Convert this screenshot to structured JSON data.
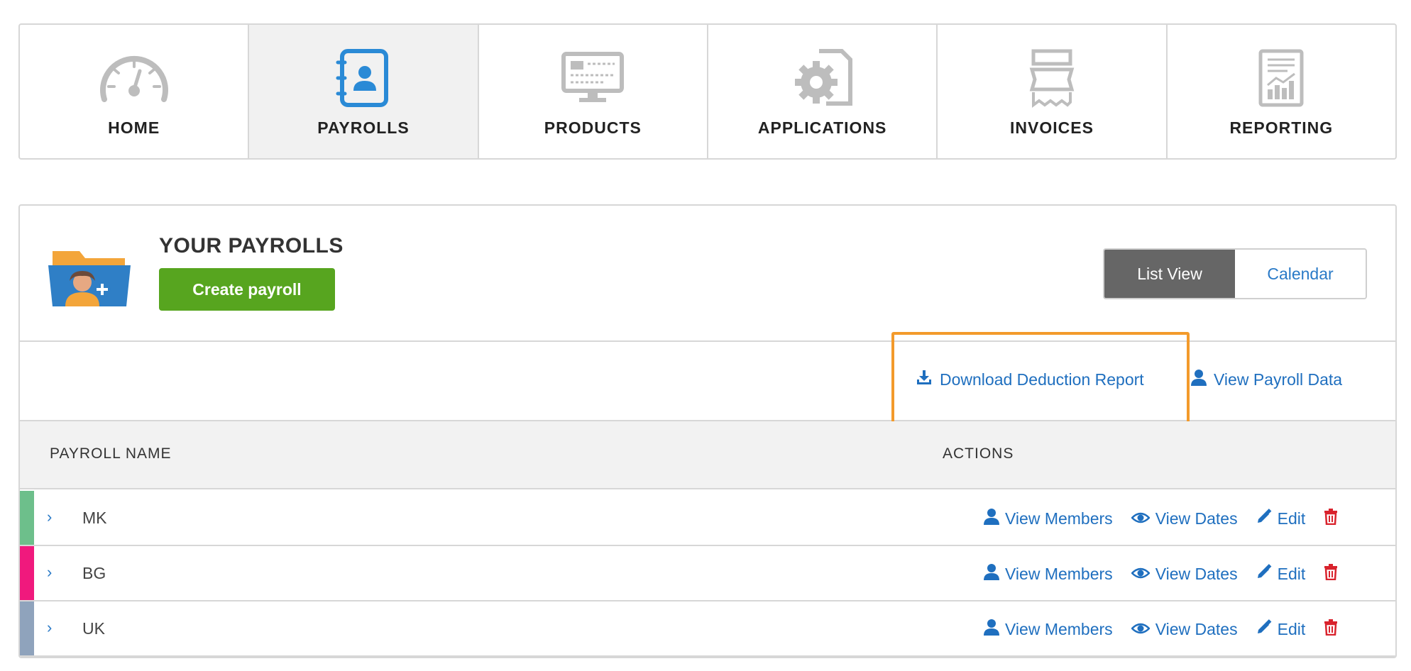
{
  "nav": {
    "tiles": [
      {
        "label": "HOME",
        "icon": "speedometer-icon"
      },
      {
        "label": "PAYROLLS",
        "icon": "contacts-book-icon"
      },
      {
        "label": "PRODUCTS",
        "icon": "monitor-icon"
      },
      {
        "label": "APPLICATIONS",
        "icon": "gear-document-icon"
      },
      {
        "label": "INVOICES",
        "icon": "receipt-icon"
      },
      {
        "label": "REPORTING",
        "icon": "report-chart-icon"
      }
    ],
    "active": "PAYROLLS"
  },
  "panel": {
    "title": "YOUR PAYROLLS",
    "create_label": "Create payroll",
    "view_toggle": {
      "list": "List View",
      "calendar": "Calendar",
      "active": "List View"
    },
    "toolbar": {
      "download_label": "Download Deduction Report",
      "view_payroll_label": "View Payroll Data"
    },
    "table": {
      "columns": [
        "PAYROLL NAME",
        "ACTIONS"
      ],
      "rows": [
        {
          "name": "MK",
          "color": "#6dbf8b"
        },
        {
          "name": "BG",
          "color": "#f0197d"
        },
        {
          "name": "UK",
          "color": "#8fa3bc"
        }
      ],
      "actions": {
        "view_members": "View Members",
        "view_dates": "View Dates",
        "edit": "Edit"
      }
    }
  },
  "colors": {
    "accent_blue": "#1f6fbf",
    "create_green": "#57a51f",
    "highlight_orange": "#f39a2b",
    "delete_red": "#d9232d"
  }
}
